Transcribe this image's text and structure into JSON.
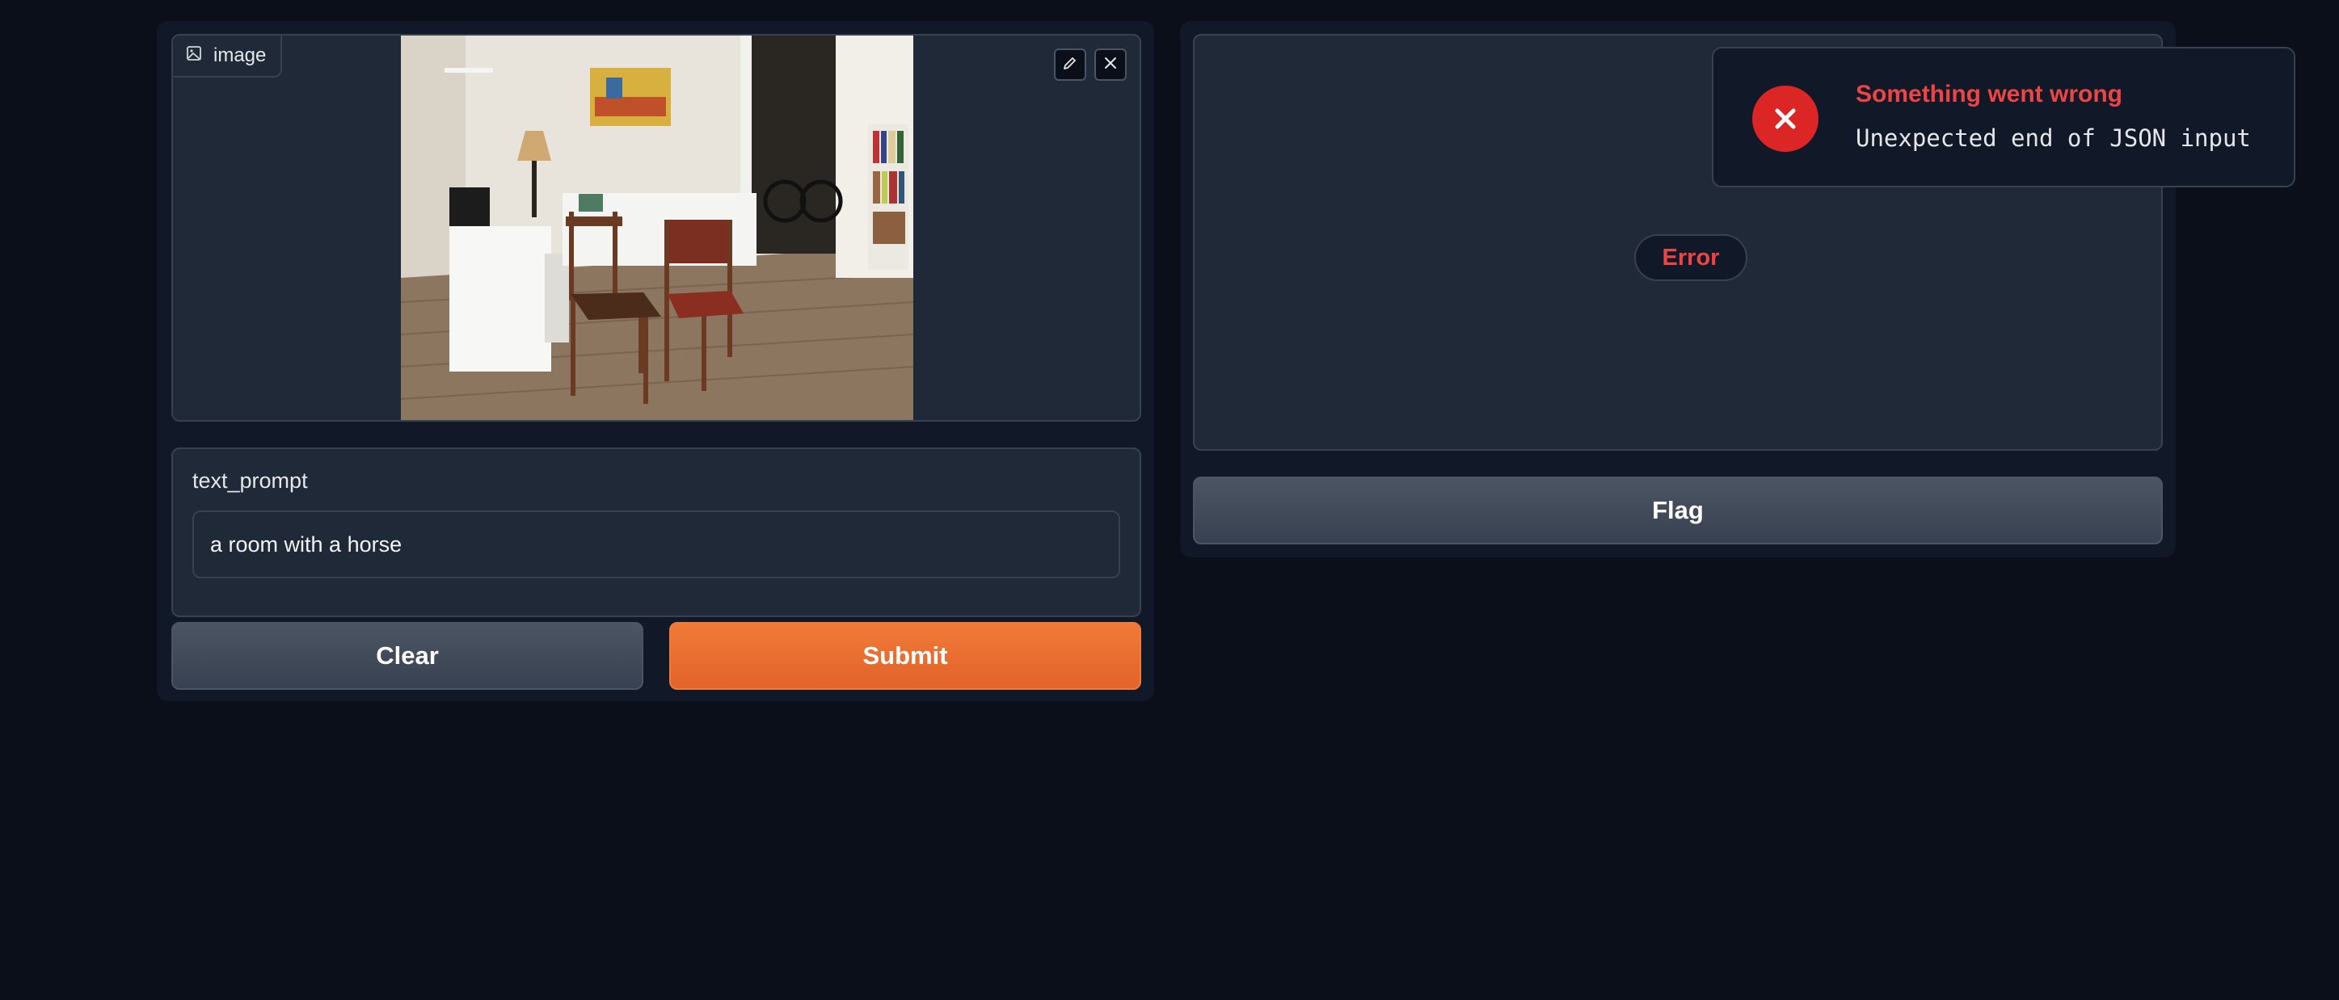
{
  "input_panel": {
    "image_label": "image",
    "image_icon": "image-icon",
    "tools": {
      "edit_icon": "pencil-icon",
      "remove_icon": "close-icon"
    },
    "text_label": "text_prompt",
    "text_value": "a room with a horse",
    "clear_label": "Clear",
    "submit_label": "Submit"
  },
  "output_panel": {
    "status": "Error",
    "flag_label": "Flag"
  },
  "toast": {
    "title": "Something went wrong",
    "message": "Unexpected end of JSON input",
    "icon": "error-x-icon"
  },
  "colors": {
    "background": "#0b0f19",
    "panel": "#111827",
    "block": "#1f2937",
    "accent": "#e8692f",
    "error": "#ef4444"
  }
}
